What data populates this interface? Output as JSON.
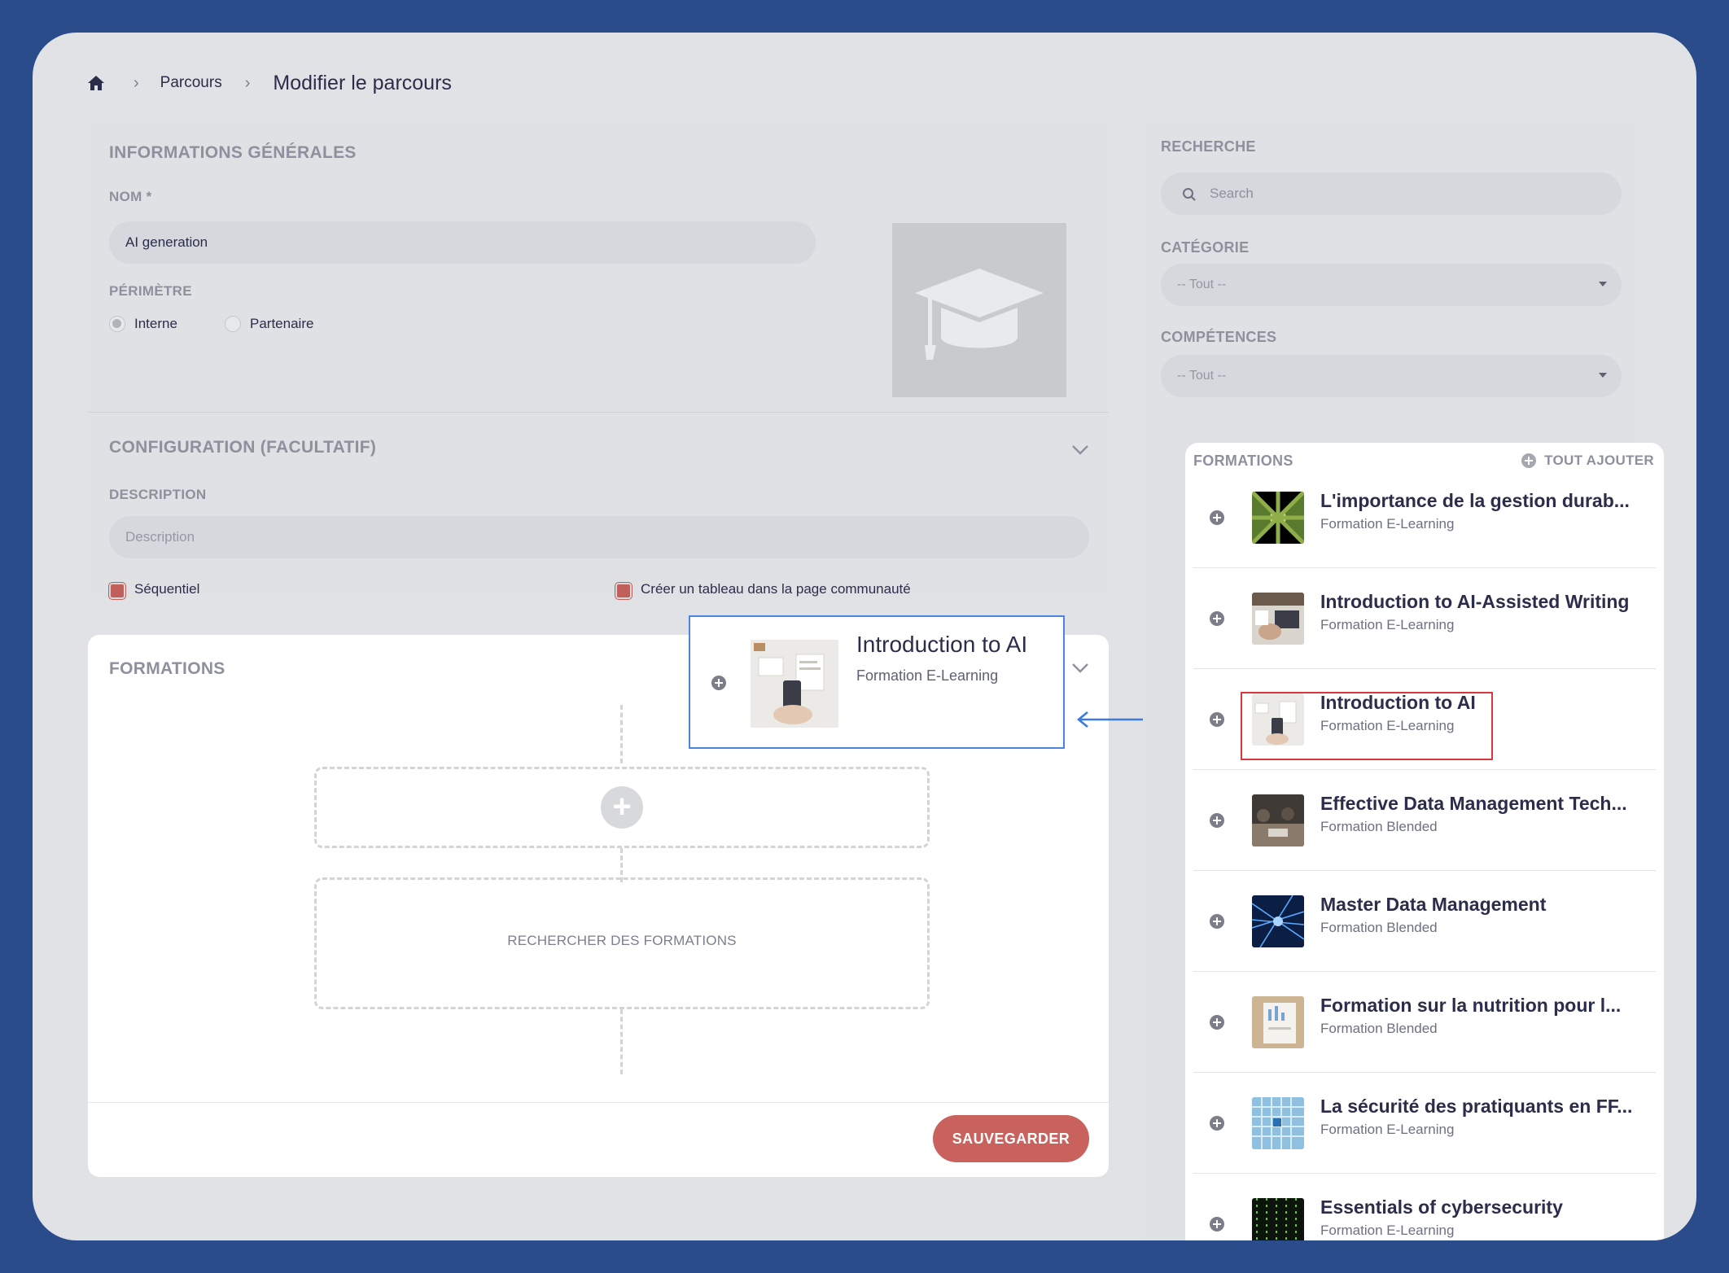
{
  "breadcrumb": {
    "home_icon": "home-icon",
    "link": "Parcours",
    "current": "Modifier le parcours"
  },
  "general": {
    "title": "INFORMATIONS GÉNÉRALES",
    "name_label": "NOM *",
    "name_value": "AI generation",
    "perimeter_label": "PÉRIMÈTRE",
    "radio_internal": "Interne",
    "radio_partner": "Partenaire",
    "thumbnail_icon": "graduation-cap-icon"
  },
  "config": {
    "title": "CONFIGURATION (FACULTATIF)",
    "description_label": "DESCRIPTION",
    "description_placeholder": "Description",
    "sequential_label": "Séquentiel",
    "community_label": "Créer un tableau dans la page communauté"
  },
  "formations_section": {
    "title": "FORMATIONS",
    "search_text": "RECHERCHER DES FORMATIONS",
    "save_label": "SAUVEGARDER"
  },
  "drag_item": {
    "title": "Introduction to AI",
    "subtitle": "Formation E-Learning"
  },
  "sidebar": {
    "search_label": "RECHERCHE",
    "search_placeholder": "Search",
    "category_label": "CATÉGORIE",
    "category_value": "-- Tout --",
    "skills_label": "COMPÉTENCES",
    "skills_value": "-- Tout --",
    "list_title": "FORMATIONS",
    "add_all": "TOUT AJOUTER",
    "items": [
      {
        "title": "L'importance de la gestion durab...",
        "subtitle": "Formation E-Learning"
      },
      {
        "title": "Introduction to AI-Assisted Writing",
        "subtitle": "Formation E-Learning"
      },
      {
        "title": "Introduction to AI",
        "subtitle": "Formation E-Learning"
      },
      {
        "title": "Effective Data Management Tech...",
        "subtitle": "Formation Blended"
      },
      {
        "title": "Master Data Management",
        "subtitle": "Formation Blended"
      },
      {
        "title": "Formation sur la nutrition pour l...",
        "subtitle": "Formation Blended"
      },
      {
        "title": "La sécurité des pratiquants en FF...",
        "subtitle": "Formation E-Learning"
      },
      {
        "title": "Essentials of cybersecurity",
        "subtitle": "Formation E-Learning"
      }
    ]
  },
  "colors": {
    "accent": "#c9615c",
    "drag_border": "#4a86e0",
    "highlight": "#d9363e",
    "background": "#2a4c8a"
  }
}
